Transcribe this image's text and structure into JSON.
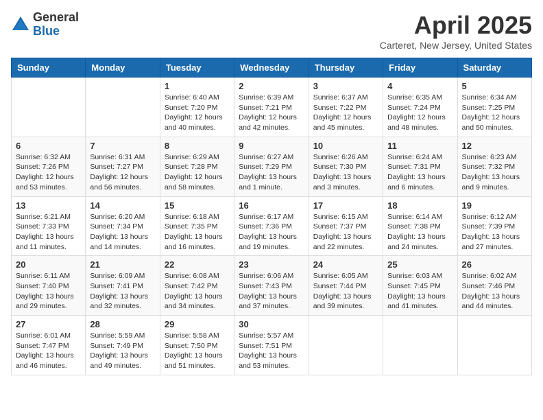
{
  "header": {
    "logo_general": "General",
    "logo_blue": "Blue",
    "title": "April 2025",
    "subtitle": "Carteret, New Jersey, United States"
  },
  "days_of_week": [
    "Sunday",
    "Monday",
    "Tuesday",
    "Wednesday",
    "Thursday",
    "Friday",
    "Saturday"
  ],
  "weeks": [
    [
      {
        "day": "",
        "info": ""
      },
      {
        "day": "",
        "info": ""
      },
      {
        "day": "1",
        "info": "Sunrise: 6:40 AM\nSunset: 7:20 PM\nDaylight: 12 hours and 40 minutes."
      },
      {
        "day": "2",
        "info": "Sunrise: 6:39 AM\nSunset: 7:21 PM\nDaylight: 12 hours and 42 minutes."
      },
      {
        "day": "3",
        "info": "Sunrise: 6:37 AM\nSunset: 7:22 PM\nDaylight: 12 hours and 45 minutes."
      },
      {
        "day": "4",
        "info": "Sunrise: 6:35 AM\nSunset: 7:24 PM\nDaylight: 12 hours and 48 minutes."
      },
      {
        "day": "5",
        "info": "Sunrise: 6:34 AM\nSunset: 7:25 PM\nDaylight: 12 hours and 50 minutes."
      }
    ],
    [
      {
        "day": "6",
        "info": "Sunrise: 6:32 AM\nSunset: 7:26 PM\nDaylight: 12 hours and 53 minutes."
      },
      {
        "day": "7",
        "info": "Sunrise: 6:31 AM\nSunset: 7:27 PM\nDaylight: 12 hours and 56 minutes."
      },
      {
        "day": "8",
        "info": "Sunrise: 6:29 AM\nSunset: 7:28 PM\nDaylight: 12 hours and 58 minutes."
      },
      {
        "day": "9",
        "info": "Sunrise: 6:27 AM\nSunset: 7:29 PM\nDaylight: 13 hours and 1 minute."
      },
      {
        "day": "10",
        "info": "Sunrise: 6:26 AM\nSunset: 7:30 PM\nDaylight: 13 hours and 3 minutes."
      },
      {
        "day": "11",
        "info": "Sunrise: 6:24 AM\nSunset: 7:31 PM\nDaylight: 13 hours and 6 minutes."
      },
      {
        "day": "12",
        "info": "Sunrise: 6:23 AM\nSunset: 7:32 PM\nDaylight: 13 hours and 9 minutes."
      }
    ],
    [
      {
        "day": "13",
        "info": "Sunrise: 6:21 AM\nSunset: 7:33 PM\nDaylight: 13 hours and 11 minutes."
      },
      {
        "day": "14",
        "info": "Sunrise: 6:20 AM\nSunset: 7:34 PM\nDaylight: 13 hours and 14 minutes."
      },
      {
        "day": "15",
        "info": "Sunrise: 6:18 AM\nSunset: 7:35 PM\nDaylight: 13 hours and 16 minutes."
      },
      {
        "day": "16",
        "info": "Sunrise: 6:17 AM\nSunset: 7:36 PM\nDaylight: 13 hours and 19 minutes."
      },
      {
        "day": "17",
        "info": "Sunrise: 6:15 AM\nSunset: 7:37 PM\nDaylight: 13 hours and 22 minutes."
      },
      {
        "day": "18",
        "info": "Sunrise: 6:14 AM\nSunset: 7:38 PM\nDaylight: 13 hours and 24 minutes."
      },
      {
        "day": "19",
        "info": "Sunrise: 6:12 AM\nSunset: 7:39 PM\nDaylight: 13 hours and 27 minutes."
      }
    ],
    [
      {
        "day": "20",
        "info": "Sunrise: 6:11 AM\nSunset: 7:40 PM\nDaylight: 13 hours and 29 minutes."
      },
      {
        "day": "21",
        "info": "Sunrise: 6:09 AM\nSunset: 7:41 PM\nDaylight: 13 hours and 32 minutes."
      },
      {
        "day": "22",
        "info": "Sunrise: 6:08 AM\nSunset: 7:42 PM\nDaylight: 13 hours and 34 minutes."
      },
      {
        "day": "23",
        "info": "Sunrise: 6:06 AM\nSunset: 7:43 PM\nDaylight: 13 hours and 37 minutes."
      },
      {
        "day": "24",
        "info": "Sunrise: 6:05 AM\nSunset: 7:44 PM\nDaylight: 13 hours and 39 minutes."
      },
      {
        "day": "25",
        "info": "Sunrise: 6:03 AM\nSunset: 7:45 PM\nDaylight: 13 hours and 41 minutes."
      },
      {
        "day": "26",
        "info": "Sunrise: 6:02 AM\nSunset: 7:46 PM\nDaylight: 13 hours and 44 minutes."
      }
    ],
    [
      {
        "day": "27",
        "info": "Sunrise: 6:01 AM\nSunset: 7:47 PM\nDaylight: 13 hours and 46 minutes."
      },
      {
        "day": "28",
        "info": "Sunrise: 5:59 AM\nSunset: 7:49 PM\nDaylight: 13 hours and 49 minutes."
      },
      {
        "day": "29",
        "info": "Sunrise: 5:58 AM\nSunset: 7:50 PM\nDaylight: 13 hours and 51 minutes."
      },
      {
        "day": "30",
        "info": "Sunrise: 5:57 AM\nSunset: 7:51 PM\nDaylight: 13 hours and 53 minutes."
      },
      {
        "day": "",
        "info": ""
      },
      {
        "day": "",
        "info": ""
      },
      {
        "day": "",
        "info": ""
      }
    ]
  ]
}
